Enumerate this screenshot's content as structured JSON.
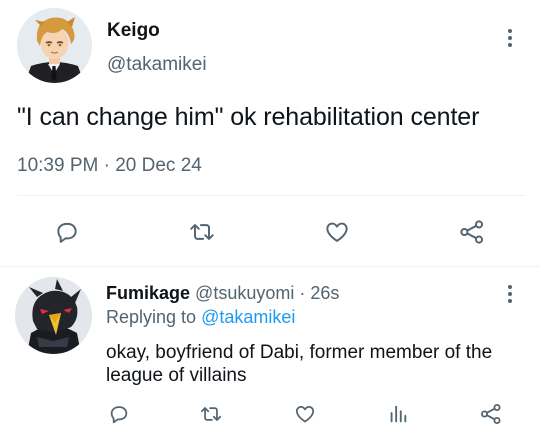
{
  "main_tweet": {
    "display_name": "Keigo",
    "handle": "@takamikei",
    "text": "\"I can change him\" ok rehabilitation center",
    "timestamp": "10:39 PM · 20 Dec 24",
    "actions": [
      "reply-icon",
      "retweet-icon",
      "like-icon",
      "share-icon"
    ]
  },
  "reply": {
    "display_name": "Fumikage",
    "handle": "@tsukuyomi",
    "separator": "·",
    "time": "26s",
    "replying_prefix": "Replying to",
    "replying_to": "@takamikei",
    "text": "okay, boyfriend of Dabi, former member of the league of villains",
    "actions": [
      "reply-icon",
      "retweet-icon",
      "like-icon",
      "analytics-icon",
      "share-icon"
    ]
  },
  "colors": {
    "text": "#0f1419",
    "secondary": "#536471",
    "link": "#1d9bf0",
    "divider": "#eff3f4"
  }
}
